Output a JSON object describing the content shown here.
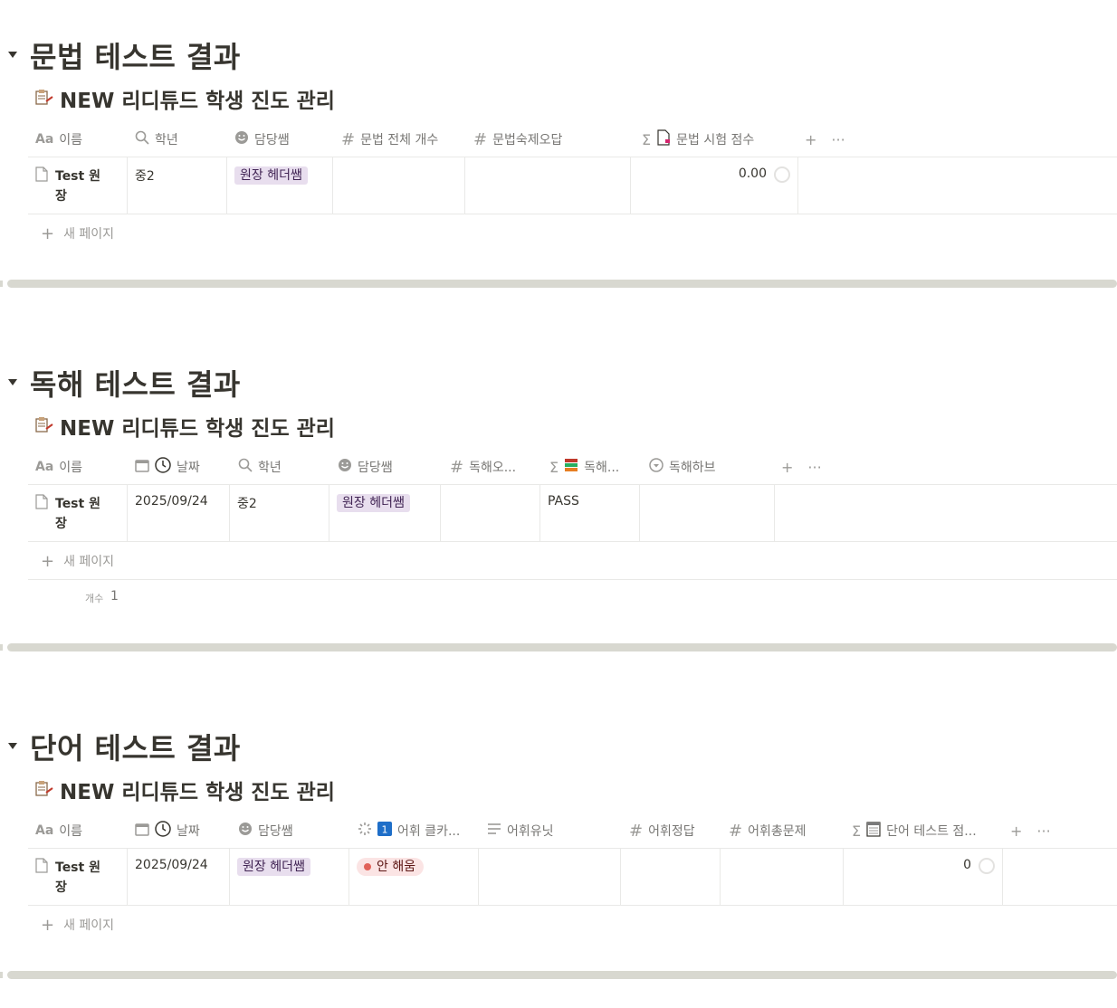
{
  "sections": [
    {
      "heading": "문법 테스트 결과",
      "db_title": "NEW 리디튜드 학생 진도 관리",
      "columns": [
        "이름",
        "학년",
        "담당쌤",
        "문법 전체 개수",
        "문법숙제오답",
        "문법 시험 점수"
      ],
      "row": {
        "name": "Test 원장",
        "grade": "중2",
        "teacher": "원장 헤더쌤",
        "score": "0.00"
      },
      "new_page": "새 페이지"
    },
    {
      "heading": "독해 테스트 결과",
      "db_title": "NEW 리디튜드 학생 진도 관리",
      "columns": [
        "이름",
        "날짜",
        "학년",
        "담당쌤",
        "독해오...",
        "독해...",
        "독해하브"
      ],
      "row": {
        "name": "Test 원장",
        "date": "2025/09/24",
        "grade": "중2",
        "teacher": "원장 헤더쌤",
        "result": "PASS"
      },
      "new_page": "새 페이지",
      "count_label": "개수",
      "count_value": "1"
    },
    {
      "heading": "단어 테스트 결과",
      "db_title": "NEW 리디튜드 학생 진도 관리",
      "columns": [
        "이름",
        "날짜",
        "담당쌤",
        "어휘 클카...",
        "어휘유닛",
        "어휘정답",
        "어휘총문제",
        "단어 테스트 점..."
      ],
      "row": {
        "name": "Test 원장",
        "date": "2025/09/24",
        "teacher": "원장 헤더쌤",
        "status": "안 해움",
        "score": "0"
      },
      "new_page": "새 페이지"
    }
  ],
  "symbols": {
    "plus": "+",
    "more": "···"
  },
  "colors": {
    "tag_purple_bg": "#e8deee",
    "status_red_bg": "#fbe4e4",
    "status_dot": "#e16259",
    "divider": "#d8d8d0"
  }
}
